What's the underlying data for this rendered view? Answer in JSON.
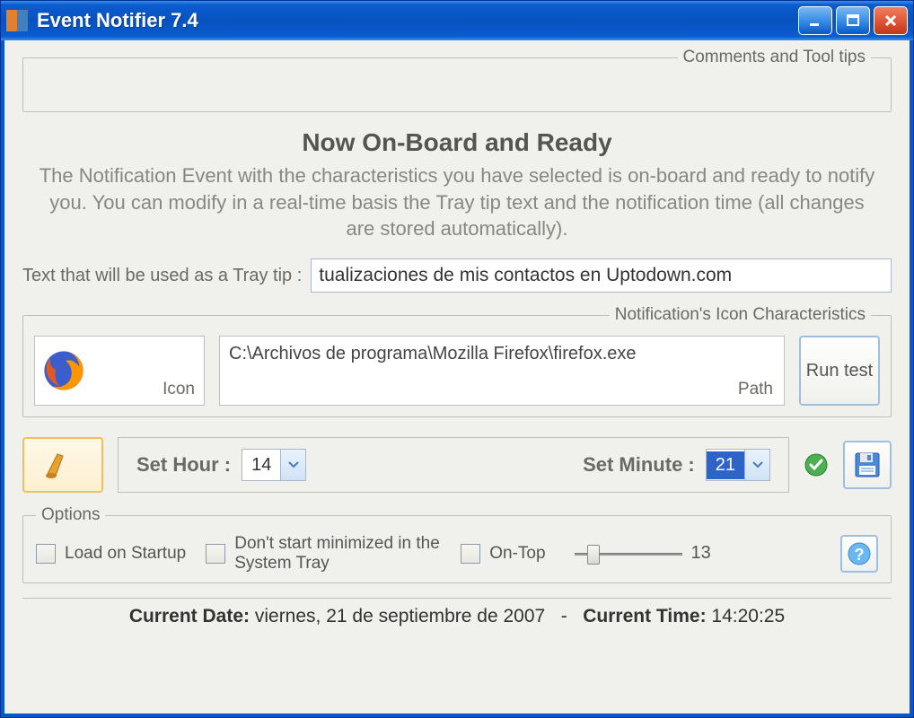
{
  "window": {
    "title": "Event Notifier 7.4"
  },
  "comments": {
    "legend": "Comments and Tool tips"
  },
  "main": {
    "heading": "Now On-Board and Ready",
    "description": "The Notification Event with the characteristics you have selected is on-board and ready to notify you. You can modify in a real-time basis the Tray tip text and the notification time (all changes are stored automatically)."
  },
  "tray": {
    "label": "Text that will be used as a Tray tip :",
    "value": "tualizaciones de mis contactos en Uptodown.com"
  },
  "iconSection": {
    "legend": "Notification's Icon Characteristics",
    "iconLabel": "Icon",
    "path": "C:\\Archivos de programa\\Mozilla Firefox\\firefox.exe",
    "pathLabel": "Path",
    "runTest": "Run test"
  },
  "time": {
    "hourLabel": "Set Hour :",
    "hourValue": "14",
    "minuteLabel": "Set Minute :",
    "minuteValue": "21"
  },
  "options": {
    "legend": "Options",
    "loadStartup": "Load on Startup",
    "dontStartMin": "Don't start minimized in the System Tray",
    "onTop": "On-Top",
    "sliderValue": "13"
  },
  "status": {
    "dateLabel": "Current Date:",
    "dateValue": "viernes, 21 de septiembre de 2007",
    "separator": "-",
    "timeLabel": "Current Time:",
    "timeValue": "14:20:25"
  }
}
